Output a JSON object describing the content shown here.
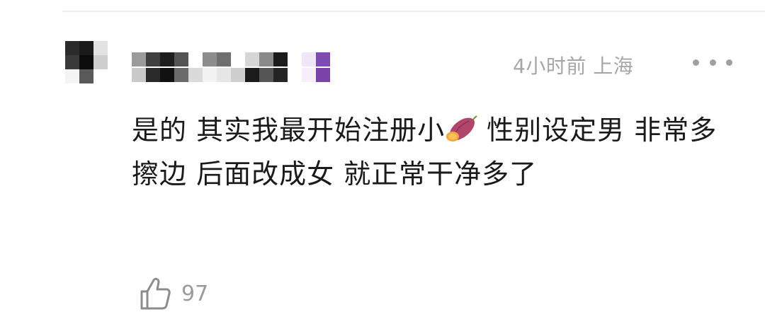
{
  "comment": {
    "avatar": {
      "mosaic_colors": [
        "#2b2b2b",
        "#1a1a1a",
        "#e2e2e2",
        "#3a3a3a",
        "#0c0c0c",
        "#cfcfcf",
        "#f4f4f4",
        "#5a5a5a",
        "#ffffff"
      ]
    },
    "username": {
      "mosaic_colors": [
        "#9b9b9b",
        "#3f3f3f",
        "#1e1e1e",
        "#555555",
        "#ffffff",
        "#8d8d8d",
        "#6f6f6f",
        "#ffffff",
        "#d6d6d6",
        "#8a8a8a",
        "#1b1b1b",
        "#ffffff",
        "#f1e6f7",
        "#7e4bb0",
        "#ffffff",
        "#ffffff",
        "#c9c9c9",
        "#2a2a2a",
        "#111111",
        "#6a6a6a",
        "#dadada",
        "#f2f2f2",
        "#e6e6e6",
        "#cfcfcf",
        "#1b1b1b",
        "#565656",
        "#242424",
        "#ffffff",
        "#f6eefb",
        "#7a43aa",
        "#ffffff",
        "#ffffff"
      ]
    },
    "time": "4小时前",
    "location": "上海",
    "text_part1": "是的 其实我最开始注册小",
    "text_part2": " 性别设定男 非常多擦边 后面改成女 就正常干净多了",
    "emoji": "sweet-potato-icon",
    "like_count": "97"
  },
  "colors": {
    "meta": "#a6a6a6",
    "text": "#1a1a1a",
    "like": "#9a9a9a"
  }
}
